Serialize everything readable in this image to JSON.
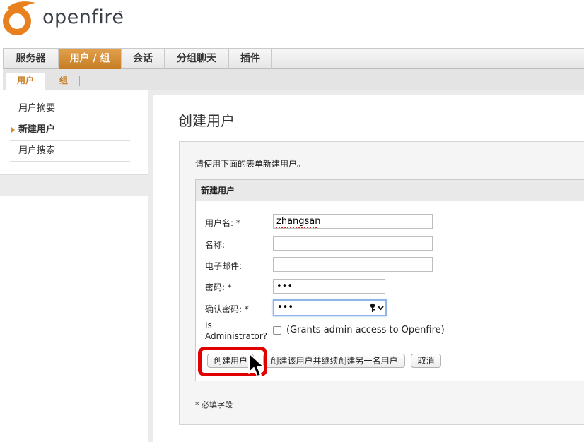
{
  "app": {
    "logo_text": "openfire",
    "logo_tm": "™"
  },
  "main_nav": {
    "tabs": [
      {
        "label": "服务器",
        "active": false
      },
      {
        "label": "用户 / 组",
        "active": true
      },
      {
        "label": "会话",
        "active": false
      },
      {
        "label": "分组聊天",
        "active": false
      },
      {
        "label": "插件",
        "active": false
      }
    ]
  },
  "sub_nav": {
    "tabs": [
      {
        "label": "用户",
        "active": true
      },
      {
        "label": "组",
        "active": false
      }
    ]
  },
  "sidebar": {
    "items": [
      {
        "label": "用户摘要",
        "active": false
      },
      {
        "label": "新建用户",
        "active": true
      },
      {
        "label": "用户搜索",
        "active": false
      }
    ]
  },
  "page": {
    "title": "创建用户",
    "intro": "请使用下面的表单新建用户。",
    "required_note": "* 必填字段"
  },
  "form": {
    "header": "新建用户",
    "username_label": "用户名: *",
    "username_value": "zhangsan",
    "name_label": "名称:",
    "name_value": "",
    "email_label": "电子邮件:",
    "email_value": "",
    "password_label": "密码: *",
    "password_value": "•••",
    "confirm_label": "确认密码: *",
    "confirm_value": "•••",
    "admin_label_line1": "Is",
    "admin_label_line2": "Administrator?",
    "admin_checked": false,
    "admin_description": "(Grants admin access to Openfire)",
    "buttons": {
      "create": "创建用户",
      "create_another": "创建该用户并继续创建另一名用户",
      "cancel": "取消"
    }
  },
  "colors": {
    "accent_orange": "#c67d24",
    "highlight_red": "#e00000"
  },
  "icons": {
    "logo": "openfire-flame-icon",
    "key": "key-icon",
    "chevron": "chevron-down-icon",
    "cursor": "mouse-pointer-icon"
  }
}
